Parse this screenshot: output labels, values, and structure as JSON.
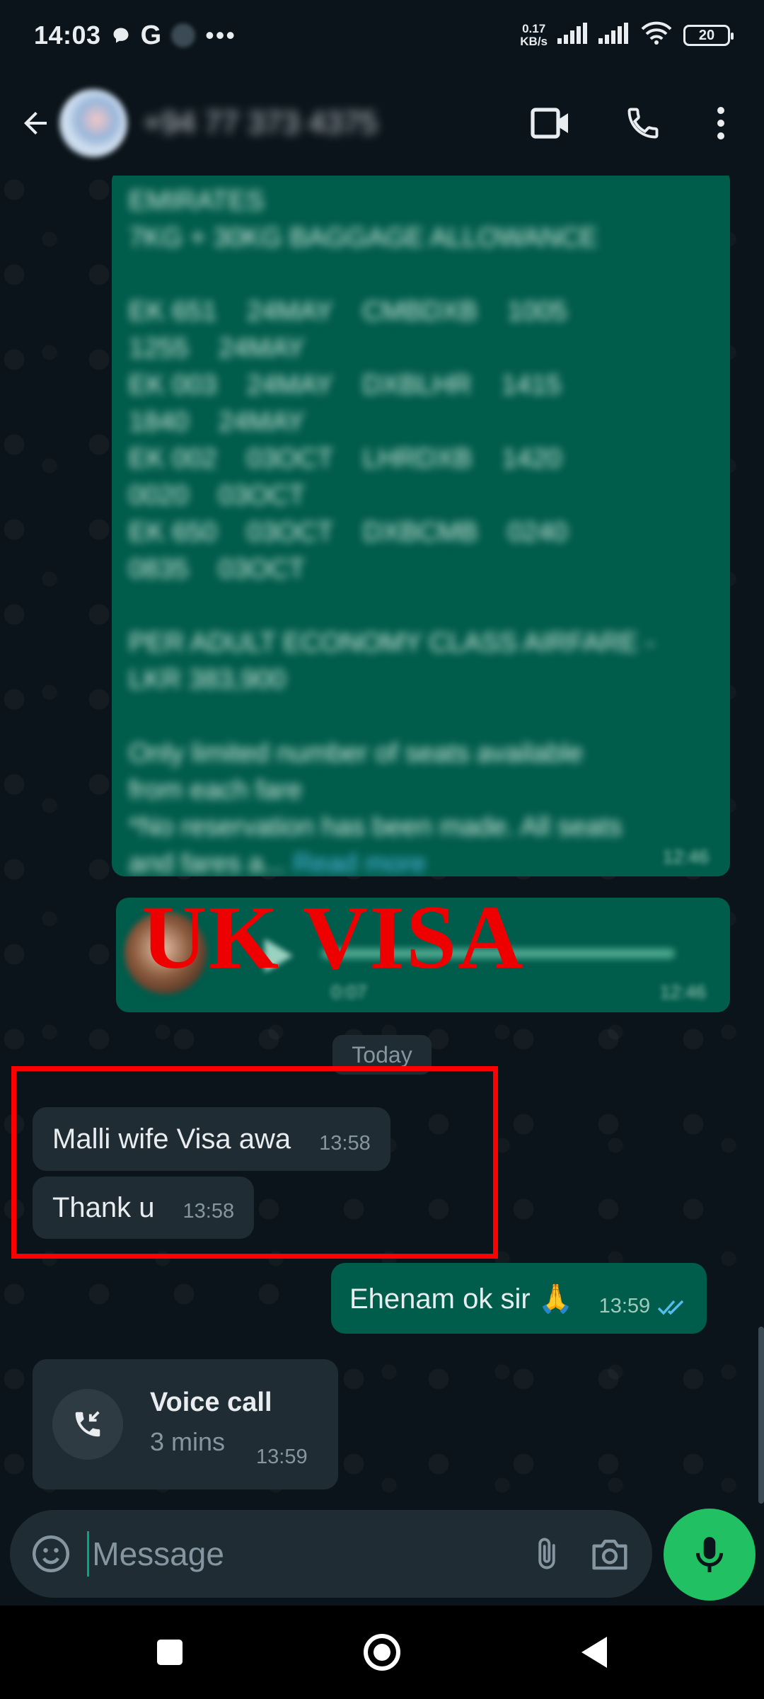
{
  "status_bar": {
    "time": "14:03",
    "net_speed_value": "0.17",
    "net_speed_unit": "KB/s",
    "battery": "20",
    "icons": [
      "chat-icon",
      "google-icon",
      "more-icon",
      "signal-icon",
      "signal-icon",
      "wifi-icon",
      "battery-icon"
    ]
  },
  "header": {
    "contact": "+94 77 373 4375",
    "icons": [
      "back-arrow-icon",
      "video-call-icon",
      "phone-icon",
      "more-vertical-icon"
    ]
  },
  "messages": {
    "forwarded_text": "EMIRATES\n7KG + 30KG BAGGAGE ALLOWANCE\n\nEK 651    24MAY    CMBDXB    1005\n1255    24MAY\nEK 003    24MAY    DXBLHR    1415\n1840    24MAY\nEK 002    03OCT    LHRDXB    1420\n0020    03OCT\nEK 650    03OCT    DXBCMB    0240\n0835    03OCT\n\nPER ADULT ECONOMY CLASS AIRFARE -\nLKR 383,900\n\nOnly limited number of seats available\nfrom each fare\n*No reservation has been made. All seats\nand fares a... ",
    "read_more": "Read more",
    "forwarded_time": "12:46",
    "audio_duration": "0:07",
    "audio_time": "12:46",
    "overlay_label": "UK VISA",
    "date_chip": "Today",
    "incoming": [
      {
        "text": "Malli wife Visa awa",
        "time": "13:58"
      },
      {
        "text": "Thank u",
        "time": "13:58"
      }
    ],
    "outgoing": {
      "text": "Ehenam ok sir 🙏",
      "time": "13:59"
    },
    "call": {
      "title": "Voice call",
      "duration": "3 mins",
      "time": "13:59"
    }
  },
  "composer": {
    "placeholder": "Message",
    "icons": [
      "emoji-icon",
      "attach-icon",
      "camera-icon",
      "mic-icon"
    ]
  },
  "colors": {
    "background": "#0b141a",
    "outgoing_bubble": "#005c4b",
    "incoming_bubble": "#202c33",
    "accent_green": "#21c063",
    "read_tick_blue": "#53bdeb",
    "annotation_red": "#ff0000"
  },
  "navbar": {
    "icons": [
      "recents-icon",
      "home-icon",
      "back-icon"
    ]
  }
}
